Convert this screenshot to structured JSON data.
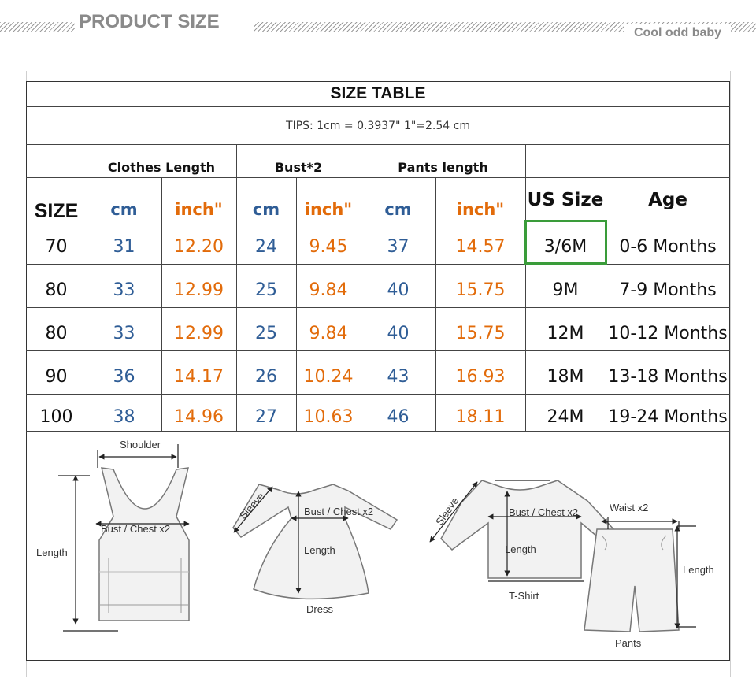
{
  "header": {
    "title": "PRODUCT SIZE",
    "brand": "Cool odd baby"
  },
  "table": {
    "title": "SIZE TABLE",
    "tips": "TIPS: 1cm = 0.3937\"   1\"=2.54 cm",
    "groups": {
      "clothes_length": "Clothes Length",
      "bust": "Bust*2",
      "pants_length": "Pants length"
    },
    "columns": {
      "size": "SIZE",
      "cm": "cm",
      "inch": "inch\"",
      "us_size": "US Size",
      "age": "Age"
    },
    "rows": [
      {
        "size": "70",
        "cl_cm": "31",
        "cl_in": "12.20",
        "b_cm": "24",
        "b_in": "9.45",
        "p_cm": "37",
        "p_in": "14.57",
        "us": "3/6M",
        "age": "0-6 Months"
      },
      {
        "size": "80",
        "cl_cm": "33",
        "cl_in": "12.99",
        "b_cm": "25",
        "b_in": "9.84",
        "p_cm": "40",
        "p_in": "15.75",
        "us": "9M",
        "age": "7-9 Months"
      },
      {
        "size": "80",
        "cl_cm": "33",
        "cl_in": "12.99",
        "b_cm": "25",
        "b_in": "9.84",
        "p_cm": "40",
        "p_in": "15.75",
        "us": "12M",
        "age": "10-12 Months"
      },
      {
        "size": "90",
        "cl_cm": "36",
        "cl_in": "14.17",
        "b_cm": "26",
        "b_in": "10.24",
        "p_cm": "43",
        "p_in": "16.93",
        "us": "18M",
        "age": "13-18 Months"
      },
      {
        "size": "100",
        "cl_cm": "38",
        "cl_in": "14.96",
        "b_cm": "27",
        "b_in": "10.63",
        "p_cm": "46",
        "p_in": "18.11",
        "us": "24M",
        "age": "19-24 Months"
      }
    ],
    "selected_cell": "3/6M"
  },
  "diagrams": {
    "vest": {
      "shoulder": "Shoulder",
      "bust": "Bust / Chest x2",
      "length": "Length"
    },
    "dress": {
      "sleeve": "Sleeve",
      "bust": "Bust / Chest x2",
      "length": "Length",
      "caption": "Dress"
    },
    "tshirt": {
      "sleeve": "Sleeve",
      "bust": "Bust / Chest x2",
      "length": "Length",
      "caption": "T-Shirt"
    },
    "pants": {
      "waist": "Waist x2",
      "length": "Length",
      "caption": "Pants"
    }
  },
  "colors": {
    "cm": "#2f5d96",
    "inch": "#e26b0a",
    "selection": "#3a9c3a",
    "header_text": "#8a8a8a"
  }
}
